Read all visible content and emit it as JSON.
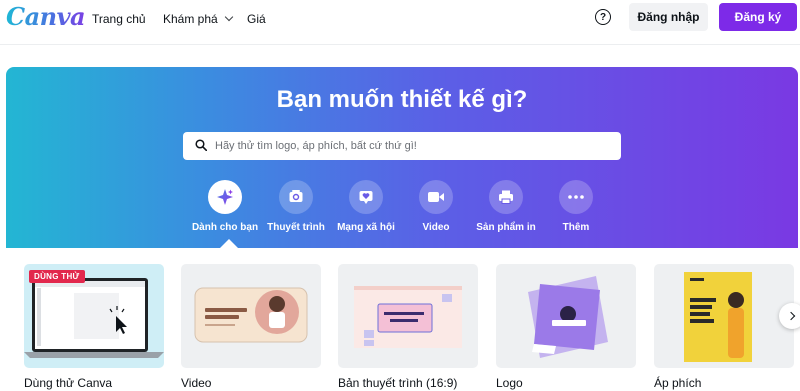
{
  "header": {
    "logo": "Canva",
    "nav": {
      "home": "Trang chủ",
      "explore": "Khám phá",
      "pricing": "Giá"
    },
    "help": "?",
    "login": "Đăng nhập",
    "signup": "Đăng ký"
  },
  "hero": {
    "title": "Bạn muốn thiết kế gì?",
    "search_placeholder": "Hãy thử tìm logo, áp phích, bất cứ thứ gì!",
    "categories": [
      {
        "label": "Dành cho bạn",
        "icon": "sparkle-icon",
        "active": true
      },
      {
        "label": "Thuyết trình",
        "icon": "presentation-icon",
        "active": false
      },
      {
        "label": "Mạng xã hội",
        "icon": "heart-icon",
        "active": false
      },
      {
        "label": "Video",
        "icon": "video-camera-icon",
        "active": false
      },
      {
        "label": "Sản phẩm in",
        "icon": "printer-icon",
        "active": false
      },
      {
        "label": "Thêm",
        "icon": "more-icon",
        "active": false
      }
    ]
  },
  "cards": [
    {
      "label": "Dùng thử Canva",
      "badge": "DÙNG THỬ"
    },
    {
      "label": "Video",
      "thumb_text": "Tin đồ ăn uống lành mạnh"
    },
    {
      "label": "Bản thuyết trình (16:9)",
      "thumb_text": "Chân dung tự họa"
    },
    {
      "label": "Logo"
    },
    {
      "label": "Áp phích",
      "thumb_text": "Bạn nghĩ mình đủ điều kiện?"
    }
  ],
  "colors": {
    "brand_purple": "#7d2ae8",
    "badge_red": "#e2284d",
    "hero_start": "#23b6d3",
    "hero_end": "#7a39e3"
  }
}
